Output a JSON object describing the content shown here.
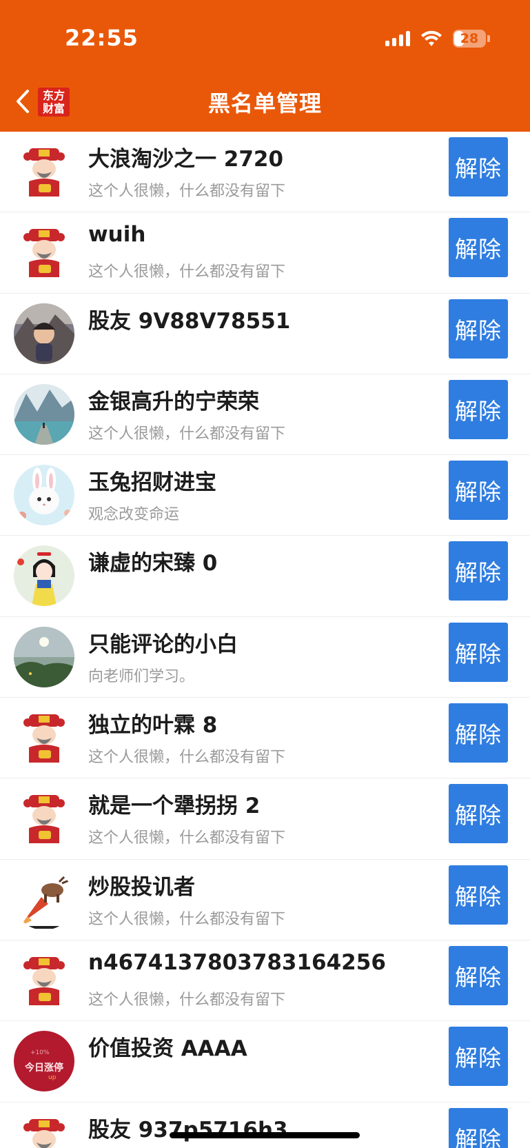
{
  "status_bar": {
    "time": "22:55",
    "battery": "28"
  },
  "header": {
    "title": "黑名单管理",
    "logo_line1": "东方",
    "logo_line2": "财富",
    "accent_color": "#e95808"
  },
  "unblock_label": "解除",
  "rows": [
    {
      "name": "大浪淘沙之一 2720",
      "bio": "这个人很懒，什么都没有留下",
      "avatar": "caishen"
    },
    {
      "name": "wuih",
      "bio": "这个人很懒，什么都没有留下",
      "avatar": "caishen"
    },
    {
      "name": "股友 9V88V78551",
      "bio": "",
      "avatar": "cartoon-boy"
    },
    {
      "name": "金银高升的宁荣荣",
      "bio": "这个人很懒，什么都没有留下",
      "avatar": "mountain-lake"
    },
    {
      "name": "玉兔招财进宝",
      "bio": "观念改变命运",
      "avatar": "white-rabbit"
    },
    {
      "name": "谦虚的宋臻 0",
      "bio": "",
      "avatar": "snow-white"
    },
    {
      "name": "只能评论的小白",
      "bio": "向老师们学习。",
      "avatar": "landscape-sun"
    },
    {
      "name": "独立的叶霖 8",
      "bio": "这个人很懒，什么都没有留下",
      "avatar": "caishen"
    },
    {
      "name": "就是一个犟拐拐 2",
      "bio": "这个人很懒，什么都没有留下",
      "avatar": "caishen"
    },
    {
      "name": "炒股投讥者",
      "bio": "这个人很懒，什么都没有留下",
      "avatar": "rocket-bull"
    },
    {
      "name": "n467413780378316​4256",
      "bio": "这个人很懒，什么都没有留下",
      "avatar": "caishen"
    },
    {
      "name": "价值投资 AAAA",
      "bio": "",
      "avatar": "red-badge"
    },
    {
      "name": "股友 937p5716h3",
      "bio": "",
      "avatar": "caishen"
    }
  ]
}
